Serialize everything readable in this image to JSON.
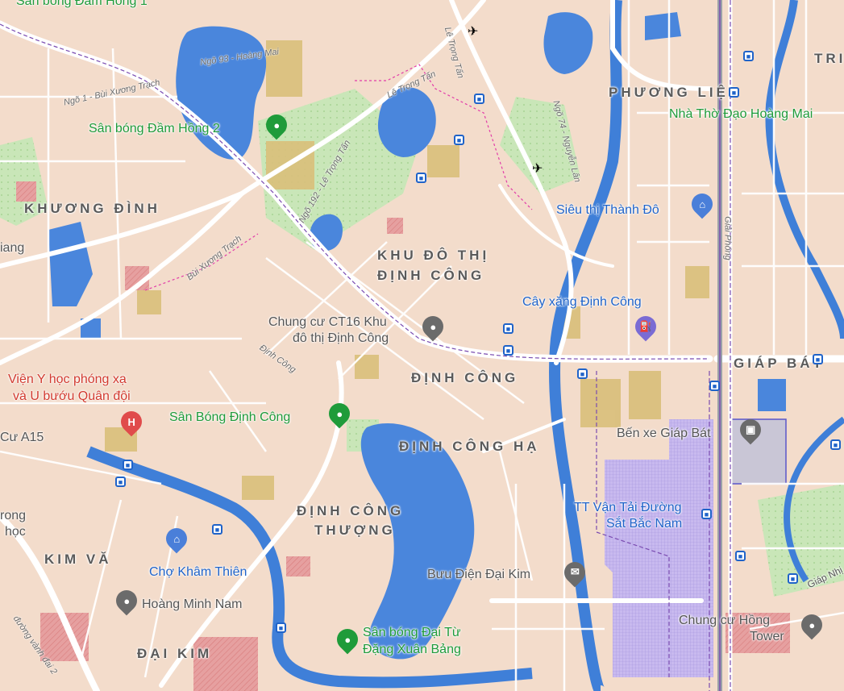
{
  "colors": {
    "land": "#f3dccb",
    "water": "#4a86dc",
    "river": "#3f7fd8",
    "park": "#c9e6b8",
    "road": "#ffffff",
    "rail": "#7a4bb0",
    "lot_yellow": "#d9bf7a",
    "lot_purple": "#b9a8e6"
  },
  "areas": {
    "khuong_dinh": "KHƯƠNG ĐÌNH",
    "khu_do_thi_1": "KHU ĐÔ THỊ",
    "khu_do_thi_2": "ĐỊNH CÔNG",
    "dinh_cong": "ĐỊNH CÔNG",
    "dinh_cong_ha": "ĐỊNH CÔNG HẠ",
    "dinh_cong_thuong_1": "ĐỊNH CÔNG",
    "dinh_cong_thuong_2": "THƯỢNG",
    "kim_van": "KIM VĂ",
    "dai_kim": "ĐẠI KIM",
    "phuong_liet": "PHƯƠNG LIỆT",
    "giap_bat": "GIÁP BÁT",
    "tri": "TRI"
  },
  "pois": {
    "san_bong_dam_hong_1": "Sân bóng Đầm Hồng 1",
    "san_bong_dam_hong_2": "Sân bóng Đầm Hồng 2",
    "chung_cu_ct16_1": "Chung cư CT16 Khu",
    "chung_cu_ct16_2": "đô thị Định Công",
    "vien_y_hoc_1": "Viện Y học phóng xạ",
    "vien_y_hoc_2": "và U bướu Quân đội",
    "san_bong_dinh_cong": "Sân Bóng Định Công",
    "sieu_thi_thanh_do": "Siêu thị Thành Đô",
    "cay_xang_dinh_cong": "Cây xăng Định Công",
    "ben_xe_giap_bat": "Bến xe Giáp Bát",
    "tt_van_tai_1": "TT Vận Tải Đường",
    "tt_van_tai_2": "Sắt Bắc Nam",
    "buu_dien_dai_kim": "Bưu Điện Đại Kim",
    "san_bong_dai_tu_1": "Sân bóng Đại Từ",
    "san_bong_dai_tu_2": "Đặng Xuân Bảng",
    "cho_kham_thien": "Chợ Khâm Thiên",
    "hoang_minh_nam": "Hoàng Minh Nam",
    "nha_tho_1": "Nhà Thờ Đạo Hoàng Mai",
    "chung_cu_hong": "Chung cư Hồng",
    "chung_cu_hong_2": "Tower",
    "cu_a15": "Cư A15",
    "rong_hoc_1": "rong",
    "rong_hoc_2": "học",
    "giap_nhi": "Giáp Nhị",
    "iang": "iang"
  },
  "streets": {
    "ngo_93": "Ngõ 93 - Hoàng Mai",
    "le_trong_tan_1": "Lê Trọng Tấn",
    "le_trong_tan_2": "Ngõ 192 - Lê Trọng Tấn",
    "bui_xuong_trach_1": "Ngõ 1 - Bùi Xương Trạch",
    "bui_xuong_trach_2": "Bùi Xương Trạch",
    "nguyen_lan": "Ngõ 74 - Nguyễn Lân",
    "le_trong_tan_3": "Lê Trọng Tấn",
    "dinh_cong_st": "Định Công",
    "giai_phong": "Giải Phóng",
    "truong_vanh": "đường vành đai 2"
  },
  "icons": [
    "stadium-pin",
    "place-pin",
    "hospital-pin",
    "shopping-pin",
    "fuel-pin",
    "bus-station-pin",
    "post-office-pin",
    "market-pin",
    "bus-stop-icon",
    "helicopter-icon",
    "church-pin",
    "apartment-pin"
  ]
}
